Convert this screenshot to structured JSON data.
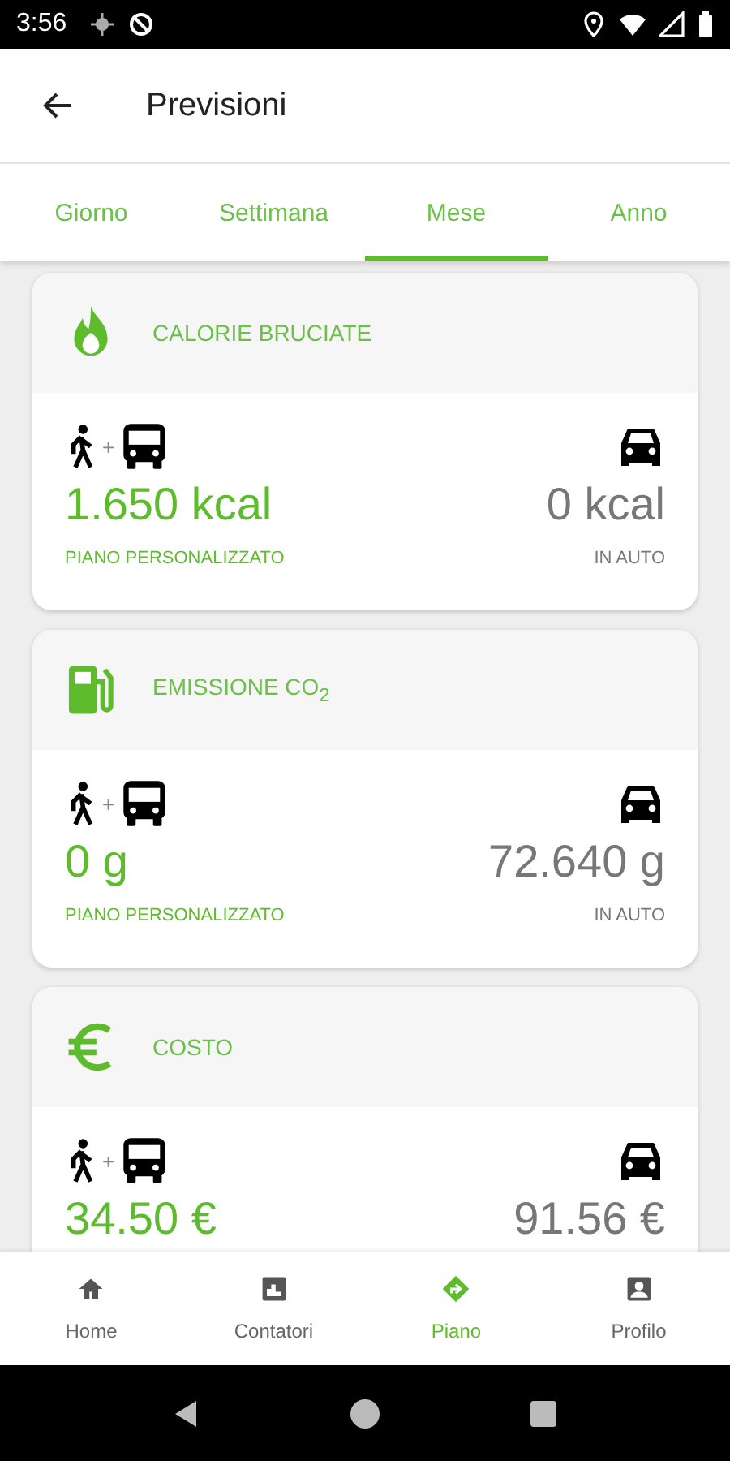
{
  "status_bar": {
    "time": "3:56"
  },
  "app_bar": {
    "title": "Previsioni"
  },
  "tabs": [
    {
      "label": "Giorno",
      "selected": false
    },
    {
      "label": "Settimana",
      "selected": false
    },
    {
      "label": "Mese",
      "selected": true
    },
    {
      "label": "Anno",
      "selected": false
    }
  ],
  "cards": [
    {
      "kind": "flame",
      "title": "CALORIE BRUCIATE",
      "joiner": "+",
      "plan_value": "1.650 kcal",
      "plan_label": "PIANO PERSONALIZZATO",
      "car_value": "0 kcal",
      "car_label": "IN AUTO"
    },
    {
      "kind": "fuel",
      "title": "EMISSIONE CO$_{2}$",
      "joiner": "+",
      "plan_value": "0 g",
      "plan_label": "PIANO PERSONALIZZATO",
      "car_value": "72.640 g",
      "car_label": "IN AUTO"
    },
    {
      "kind": "euro",
      "title": "COSTO",
      "joiner": "+",
      "plan_value": "34.50 €",
      "car_value": "91.56 €"
    }
  ],
  "bottom_nav": [
    {
      "kind": "home",
      "label": "Home",
      "selected": false
    },
    {
      "kind": "counter",
      "label": "Contatori",
      "selected": false
    },
    {
      "kind": "route",
      "label": "Piano",
      "selected": true
    },
    {
      "kind": "profile",
      "label": "Profilo",
      "selected": false
    }
  ]
}
